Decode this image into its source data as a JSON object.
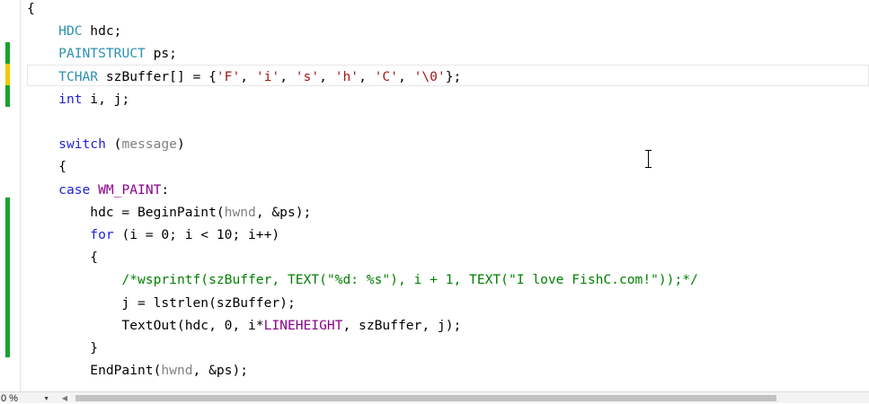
{
  "editor": {
    "lines": [
      [
        {
          "t": "{",
          "c": ""
        }
      ],
      [
        {
          "t": "    ",
          "c": ""
        },
        {
          "t": "HDC",
          "c": "ty"
        },
        {
          "t": " hdc;",
          "c": ""
        }
      ],
      [
        {
          "t": "    ",
          "c": ""
        },
        {
          "t": "PAINTSTRUCT",
          "c": "ty"
        },
        {
          "t": " ps;",
          "c": ""
        }
      ],
      [
        {
          "t": "    ",
          "c": ""
        },
        {
          "t": "TCHAR",
          "c": "ty"
        },
        {
          "t": " szBuffer[] = {",
          "c": ""
        },
        {
          "t": "'F'",
          "c": "str"
        },
        {
          "t": ", ",
          "c": ""
        },
        {
          "t": "'i'",
          "c": "str"
        },
        {
          "t": ", ",
          "c": ""
        },
        {
          "t": "'s'",
          "c": "str"
        },
        {
          "t": ", ",
          "c": ""
        },
        {
          "t": "'h'",
          "c": "str"
        },
        {
          "t": ", ",
          "c": ""
        },
        {
          "t": "'C'",
          "c": "str"
        },
        {
          "t": ", ",
          "c": ""
        },
        {
          "t": "'\\0'",
          "c": "str"
        },
        {
          "t": "};",
          "c": ""
        }
      ],
      [
        {
          "t": "    ",
          "c": ""
        },
        {
          "t": "int",
          "c": "kw"
        },
        {
          "t": " i, j;",
          "c": ""
        }
      ],
      [
        {
          "t": "",
          "c": ""
        }
      ],
      [
        {
          "t": "    ",
          "c": ""
        },
        {
          "t": "switch",
          "c": "kw"
        },
        {
          "t": " (",
          "c": ""
        },
        {
          "t": "message",
          "c": "prm"
        },
        {
          "t": ")",
          "c": ""
        }
      ],
      [
        {
          "t": "    {",
          "c": ""
        }
      ],
      [
        {
          "t": "    ",
          "c": ""
        },
        {
          "t": "case",
          "c": "kw"
        },
        {
          "t": " ",
          "c": ""
        },
        {
          "t": "WM_PAINT",
          "c": "mac"
        },
        {
          "t": ":",
          "c": ""
        }
      ],
      [
        {
          "t": "        hdc = BeginPaint(",
          "c": ""
        },
        {
          "t": "hwnd",
          "c": "prm"
        },
        {
          "t": ", &ps);",
          "c": ""
        }
      ],
      [
        {
          "t": "        ",
          "c": ""
        },
        {
          "t": "for",
          "c": "kw"
        },
        {
          "t": " (i = 0; i < 10; i++)",
          "c": ""
        }
      ],
      [
        {
          "t": "        {",
          "c": ""
        }
      ],
      [
        {
          "t": "            ",
          "c": ""
        },
        {
          "t": "/*wsprintf(szBuffer, TEXT(\"%d: %s\"), i + 1, TEXT(\"I love FishC.com!\"));*/",
          "c": "cm"
        }
      ],
      [
        {
          "t": "            j = lstrlen(szBuffer);",
          "c": ""
        }
      ],
      [
        {
          "t": "            TextOut(hdc, 0, i*",
          "c": ""
        },
        {
          "t": "LINEHEIGHT",
          "c": "mac"
        },
        {
          "t": ", szBuffer, j);",
          "c": ""
        }
      ],
      [
        {
          "t": "        }",
          "c": ""
        }
      ],
      [
        {
          "t": "        EndPaint(",
          "c": ""
        },
        {
          "t": "hwnd",
          "c": "prm"
        },
        {
          "t": ", &ps);",
          "c": ""
        }
      ]
    ],
    "change_bar_colors": {
      "saved": "#17a230",
      "unsaved": "#f2ca00"
    }
  },
  "statusbar": {
    "zoom": "0 %"
  }
}
